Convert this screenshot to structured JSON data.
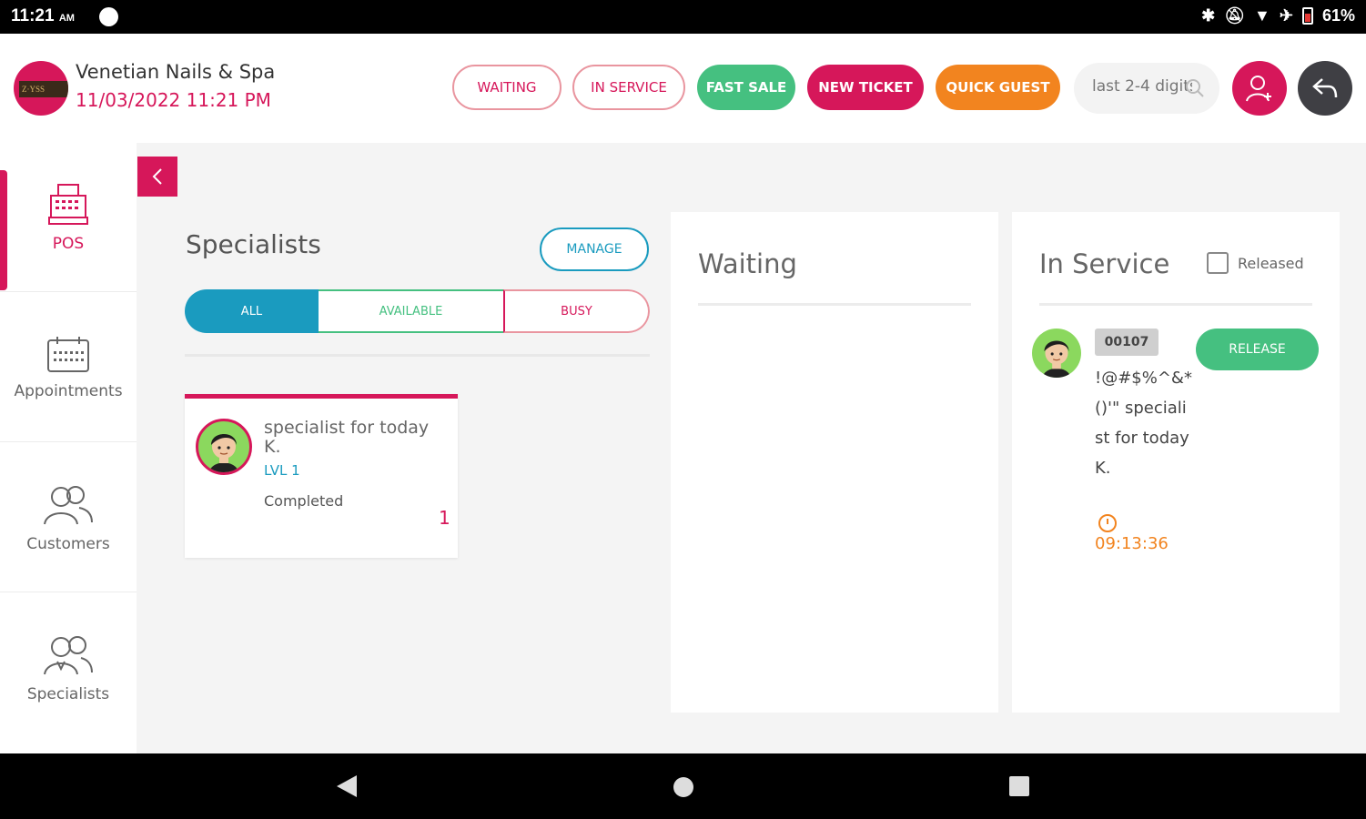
{
  "status_bar": {
    "time": "11:21",
    "ampm": "AM",
    "battery": "61%"
  },
  "header": {
    "shop_name": "Venetian Nails & Spa",
    "datetime": "11/03/2022 11:21 PM",
    "buttons": {
      "waiting": "WAITING",
      "in_service": "IN SERVICE",
      "fast_sale": "FAST SALE",
      "new_ticket": "NEW TICKET",
      "quick_guest": "QUICK GUEST"
    },
    "search_placeholder": "last 2-4 digits"
  },
  "sidebar": {
    "items": [
      {
        "label": "POS",
        "icon": "cash-register-icon",
        "active": true
      },
      {
        "label": "Appointments",
        "icon": "calendar-icon"
      },
      {
        "label": "Customers",
        "icon": "customers-icon"
      },
      {
        "label": "Specialists",
        "icon": "specialists-icon"
      }
    ]
  },
  "specialists": {
    "title": "Specialists",
    "manage_label": "MANAGE",
    "filters": {
      "all": "ALL",
      "available": "AVAILABLE",
      "busy": "BUSY"
    },
    "cards": [
      {
        "name": "specialist for today K.",
        "level": "LVL 1",
        "status": "Completed",
        "count": "1"
      }
    ]
  },
  "waiting": {
    "title": "Waiting"
  },
  "in_service": {
    "title": "In Service",
    "released_label": "Released",
    "ticket": {
      "number": "00107",
      "text": "!@#$%^&*()'\" specialist for today K.",
      "time": "09:13:36",
      "release_label": "RELEASE"
    }
  },
  "colors": {
    "primary": "#d6175a",
    "teal": "#1a9bbf",
    "green": "#45c080",
    "orange": "#f2841f"
  }
}
